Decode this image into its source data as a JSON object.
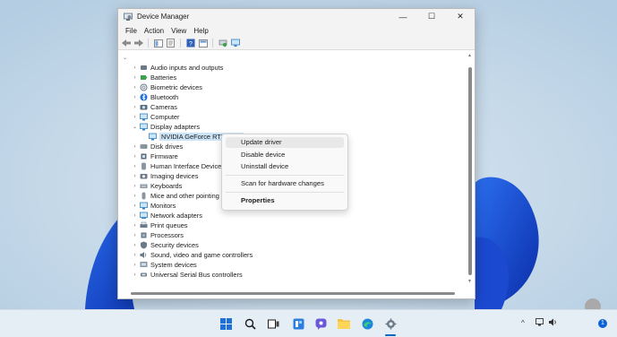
{
  "window": {
    "title": "Device Manager",
    "controls": {
      "minimize": "—",
      "maximize": "☐",
      "close": "✕"
    }
  },
  "menu": [
    "File",
    "Action",
    "View",
    "Help"
  ],
  "tree": {
    "items": [
      {
        "label": "Audio inputs and outputs",
        "icon": "speaker-icon"
      },
      {
        "label": "Batteries",
        "icon": "battery-icon"
      },
      {
        "label": "Biometric devices",
        "icon": "fingerprint-icon"
      },
      {
        "label": "Bluetooth",
        "icon": "bluetooth-icon"
      },
      {
        "label": "Cameras",
        "icon": "camera-icon"
      },
      {
        "label": "Computer",
        "icon": "computer-icon"
      },
      {
        "label": "Display adapters",
        "icon": "display-adapter-icon",
        "expanded": true
      },
      {
        "label": "NVIDIA GeForce RTX 3080",
        "icon": "display-adapter-icon",
        "child": true,
        "selected": true
      },
      {
        "label": "Disk drives",
        "icon": "disk-icon"
      },
      {
        "label": "Firmware",
        "icon": "firmware-icon"
      },
      {
        "label": "Human Interface Devices",
        "icon": "hid-icon"
      },
      {
        "label": "Imaging devices",
        "icon": "imaging-icon"
      },
      {
        "label": "Keyboards",
        "icon": "keyboard-icon"
      },
      {
        "label": "Mice and other pointing devices",
        "icon": "mouse-icon"
      },
      {
        "label": "Monitors",
        "icon": "monitor-icon"
      },
      {
        "label": "Network adapters",
        "icon": "network-icon"
      },
      {
        "label": "Print queues",
        "icon": "printer-icon"
      },
      {
        "label": "Processors",
        "icon": "processor-icon"
      },
      {
        "label": "Security devices",
        "icon": "security-icon"
      },
      {
        "label": "Sound, video and game controllers",
        "icon": "sound-icon"
      },
      {
        "label": "System devices",
        "icon": "system-icon"
      },
      {
        "label": "Universal Serial Bus controllers",
        "icon": "usb-icon"
      }
    ]
  },
  "context_menu": {
    "update_driver": "Update driver",
    "disable_device": "Disable device",
    "uninstall_device": "Uninstall device",
    "scan": "Scan for hardware changes",
    "properties": "Properties"
  },
  "taskbar": {
    "notification_count": "1"
  },
  "colors": {
    "accent": "#0067c0",
    "selection": "#cce4f7"
  }
}
